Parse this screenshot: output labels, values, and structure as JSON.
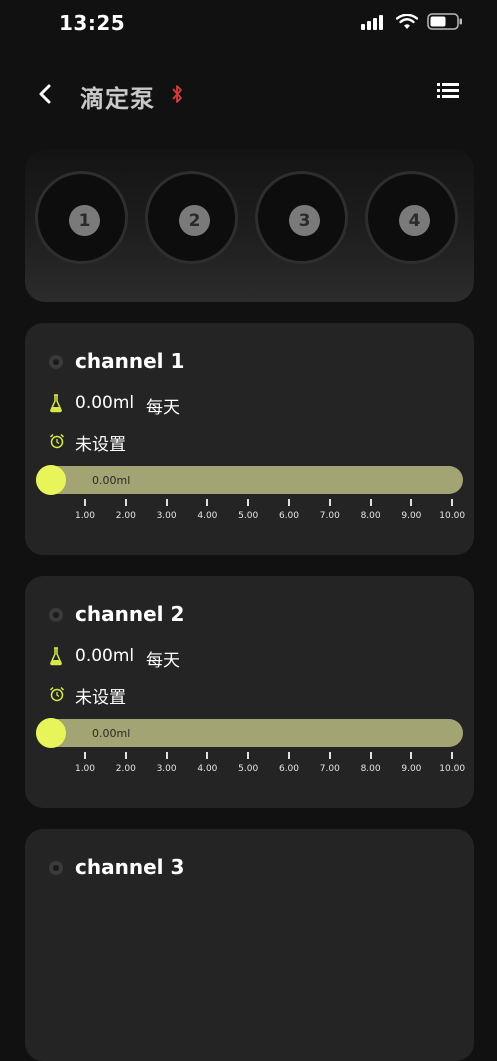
{
  "status": {
    "time": "13:25",
    "icons": [
      "signal-icon",
      "wifi-icon",
      "battery-icon"
    ]
  },
  "nav": {
    "title": "滴定泵",
    "icons": [
      "back-icon",
      "bluetooth-icon",
      "menu-list-icon"
    ]
  },
  "pumps": [
    "1",
    "2",
    "3",
    "4"
  ],
  "channels": [
    {
      "name": "channel 1",
      "volume": "0.00ml",
      "frequency": "每天",
      "schedule": "未设置",
      "slider_value": "0.00ml",
      "slider_level": 0
    },
    {
      "name": "channel 2",
      "volume": "0.00ml",
      "frequency": "每天",
      "schedule": "未设置",
      "slider_value": "0.00ml",
      "slider_level": 0
    },
    {
      "name": "channel 3"
    }
  ],
  "scale_ticks": [
    "1.00",
    "2.00",
    "3.00",
    "4.00",
    "5.00",
    "6.00",
    "7.00",
    "8.00",
    "9.00",
    "10.00"
  ],
  "colors": {
    "background": "#111111",
    "card": "#242424",
    "accent": "#e8f55a",
    "slider_track": "#a3a473",
    "bluetooth": "#d93a3a"
  }
}
